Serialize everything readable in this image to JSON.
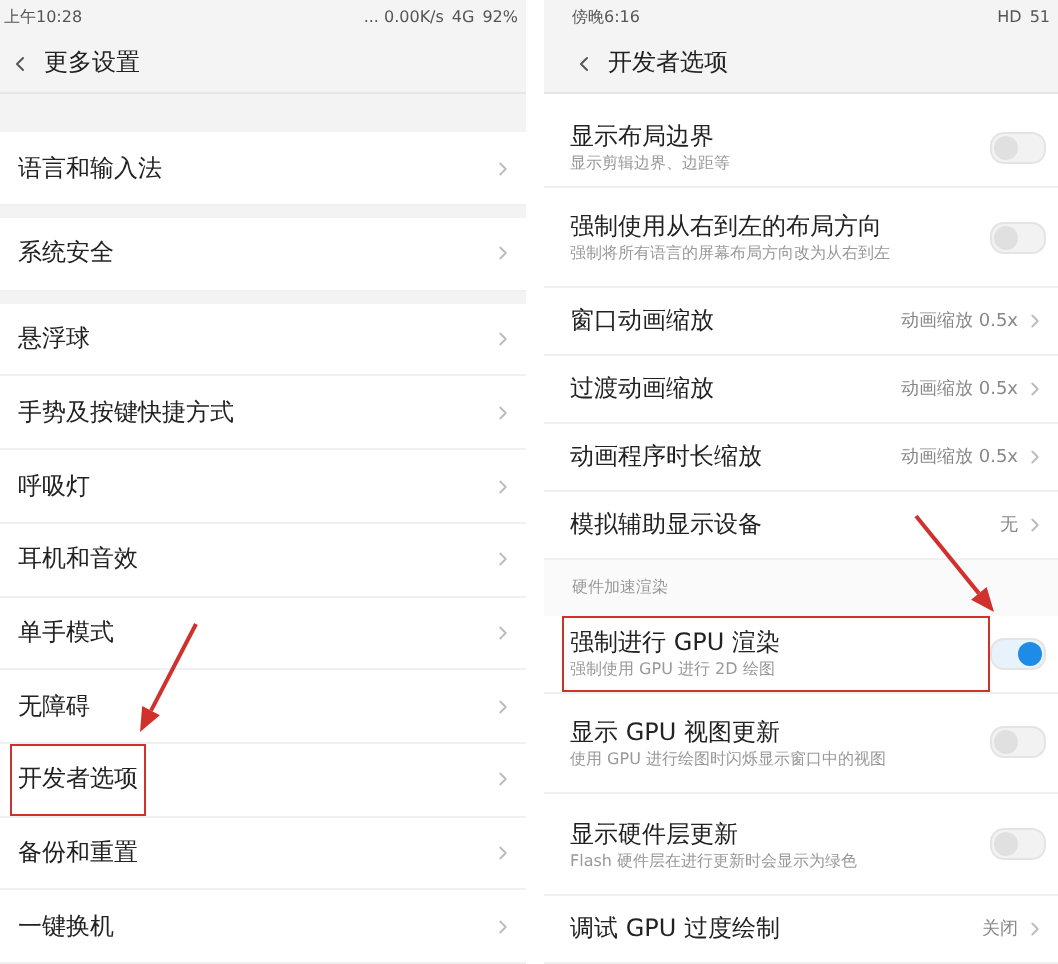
{
  "screens": [
    {
      "status_bar": {
        "time": "上午10:28",
        "network_speed": "... 0.00K/s",
        "network": "4G",
        "battery": "92%"
      },
      "header": {
        "title": "更多设置"
      },
      "groups": [
        [
          {
            "kind": "nav",
            "label": "语言和输入法",
            "highlighted": false
          }
        ],
        [
          {
            "kind": "nav",
            "label": "系统安全",
            "highlighted": false
          }
        ],
        [
          {
            "kind": "nav",
            "label": "悬浮球",
            "highlighted": false
          },
          {
            "kind": "nav",
            "label": "手势及按键快捷方式",
            "highlighted": false
          },
          {
            "kind": "nav",
            "label": "呼吸灯",
            "highlighted": false
          },
          {
            "kind": "nav",
            "label": "耳机和音效",
            "highlighted": false
          },
          {
            "kind": "nav",
            "label": "单手模式",
            "highlighted": false
          },
          {
            "kind": "nav",
            "label": "无障碍",
            "highlighted": false
          },
          {
            "kind": "nav",
            "label": "开发者选项",
            "highlighted": true
          },
          {
            "kind": "nav",
            "label": "备份和重置",
            "highlighted": false
          },
          {
            "kind": "nav",
            "label": "一键换机",
            "highlighted": false
          }
        ]
      ]
    },
    {
      "status_bar": {
        "time": "傍晚6:16",
        "network": "HD",
        "battery": "51"
      },
      "header": {
        "title": "开发者选项"
      },
      "groups": [
        [
          {
            "kind": "switch",
            "label": "显示布局边界",
            "subtitle": "显示剪辑边界、边距等",
            "on": false,
            "highlighted": false
          },
          {
            "kind": "switch",
            "label": "强制使用从右到左的布局方向",
            "subtitle": "强制将所有语言的屏幕布局方向改为从右到左",
            "on": false,
            "highlighted": false
          },
          {
            "kind": "value",
            "label": "窗口动画缩放",
            "value": "动画缩放 0.5x",
            "highlighted": false
          },
          {
            "kind": "value",
            "label": "过渡动画缩放",
            "value": "动画缩放 0.5x",
            "highlighted": false
          },
          {
            "kind": "value",
            "label": "动画程序时长缩放",
            "value": "动画缩放 0.5x",
            "highlighted": false
          },
          {
            "kind": "value",
            "label": "模拟辅助显示设备",
            "value": "无",
            "highlighted": false
          },
          {
            "kind": "section",
            "label": "硬件加速渲染"
          },
          {
            "kind": "switch",
            "label": "强制进行 GPU 渲染",
            "subtitle": "强制使用 GPU 进行 2D 绘图",
            "on": true,
            "highlighted": true
          },
          {
            "kind": "switch",
            "label": "显示 GPU 视图更新",
            "subtitle": "使用 GPU 进行绘图时闪烁显示窗口中的视图",
            "on": false,
            "highlighted": false
          },
          {
            "kind": "switch",
            "label": "显示硬件层更新",
            "subtitle": "Flash 硬件层在进行更新时会显示为绿色",
            "on": false,
            "highlighted": false
          },
          {
            "kind": "value",
            "label": "调试 GPU 过度绘制",
            "value": "关闭",
            "highlighted": false
          }
        ]
      ]
    }
  ]
}
